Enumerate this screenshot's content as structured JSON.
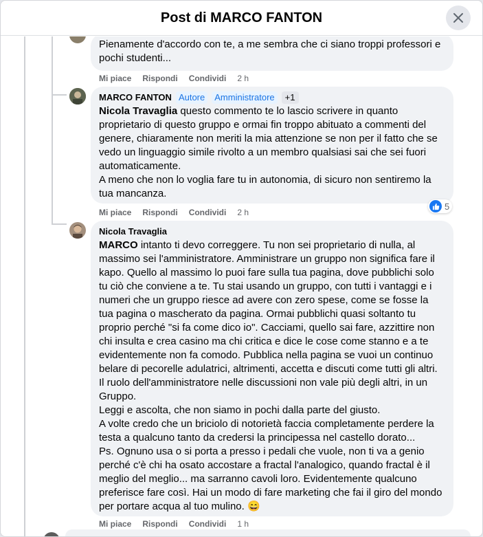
{
  "dialog": {
    "title": "Post di MARCO FANTON"
  },
  "comments": [
    {
      "text": "Pienamente d'accordo con te, a me sembra che ci siano troppi professori e pochi studenti...",
      "actions": {
        "like": "Mi piace",
        "reply": "Rispondi",
        "share": "Condividi",
        "time": "2 h"
      }
    },
    {
      "author": "MARCO FANTON",
      "badges": [
        "Autore",
        "Amministratore"
      ],
      "badge_more": "+1",
      "mention": "Nicola Travaglia",
      "text": " questo commento te lo lascio scrivere in quanto proprietario di questo gruppo e ormai fin troppo abituato a commenti del genere, chiaramente non meriti la mia attenzione se non per il fatto che se vedo un linguaggio simile rivolto a un membro qualsiasi sai che sei fuori automaticamente.\nA meno che non lo voglia fare tu in autonomia, di sicuro non sentiremo la tua mancanza.",
      "reaction_count": "5",
      "actions": {
        "like": "Mi piace",
        "reply": "Rispondi",
        "share": "Condividi",
        "time": "2 h"
      }
    },
    {
      "author": "Nicola Travaglia",
      "mention": "MARCO",
      "text": " intanto ti devo correggere. Tu non sei proprietario di nulla, al massimo sei l'amministratore. Amministrare un gruppo non significa fare il kapo. Quello al massimo lo puoi fare sulla tua pagina, dove pubblichi solo tu ciò che conviene a te. Tu stai usando un gruppo, con tutti i vantaggi e i numeri che un gruppo riesce ad avere con zero spese, come se fosse la tua pagina o mascherato da pagina. Ormai pubblichi quasi soltanto tu proprio perché \"si fa come dico io\". Cacciami, quello sai fare, azzittire non chi insulta e crea casino ma chi critica e dice le cose come stanno e a te evidentemente non fa comodo. Pubblica nella pagina se vuoi un continuo belare di pecorelle adulatrici, altrimenti, accetta e discuti come tutti gli altri.\nIl ruolo dell'amministratore nelle discussioni non vale più degli altri, in un Gruppo.\nLeggi e ascolta, che non siamo in pochi dalla parte del giusto.\nA volte credo che un briciolo di notorietà faccia completamente perdere la testa a qualcuno tanto da credersi la principessa nel castello dorato...\nPs. Ognuno usa o si porta a presso i pedali che vuole, non ti va a genio perché c'è chi ha osato accostare a fractal l'analogico, quando fractal è il meglio del meglio... ma sarranno cavoli loro. Evidentemente qualcuno preferisce fare così. Hai un modo di fare marketing che fai il giro del mondo per portare acqua al tuo mulino. 😄",
      "actions": {
        "like": "Mi piace",
        "reply": "Rispondi",
        "share": "Condividi",
        "time": "1 h"
      }
    }
  ],
  "colors": {
    "accent": "#1877f2",
    "bubble": "#f0f2f5",
    "meta": "#65676b",
    "badge_bg": "#e7f3ff",
    "badge_text": "#1b74e4"
  }
}
